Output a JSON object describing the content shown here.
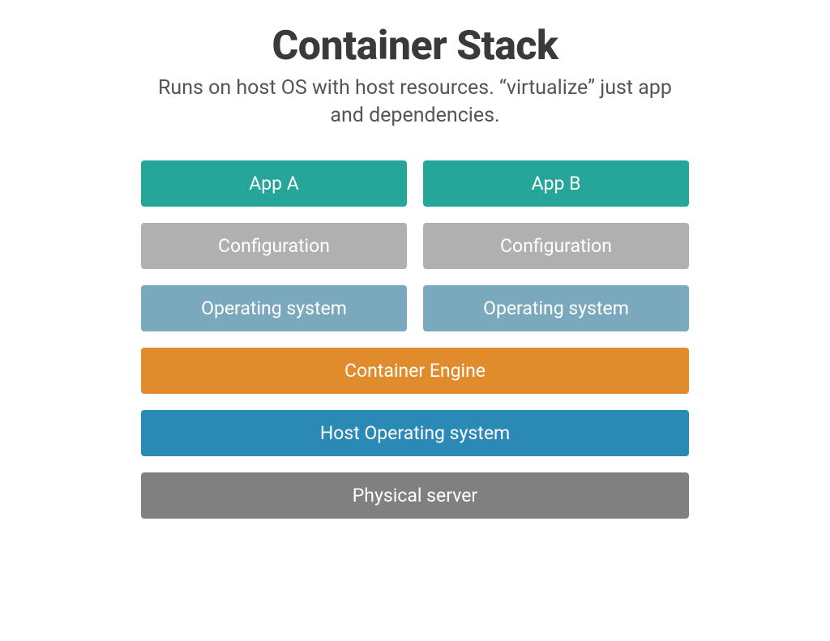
{
  "title": "Container Stack",
  "subtitle": "Runs on host OS with host resources. “virtualize” just app and dependencies.",
  "columns": {
    "left": {
      "app": "App A",
      "config": "Configuration",
      "os": "Operating system"
    },
    "right": {
      "app": "App B",
      "config": "Configuration",
      "os": "Operating system"
    }
  },
  "shared": {
    "container_engine": "Container Engine",
    "host_os": "Host Operating system",
    "physical_server": "Physical server"
  },
  "colors": {
    "teal": "#26a69a",
    "gray": "#b0b0b0",
    "lightblue": "#7aa9bd",
    "orange": "#e08b2c",
    "blue": "#2b89b6",
    "darkgray": "#808080"
  }
}
